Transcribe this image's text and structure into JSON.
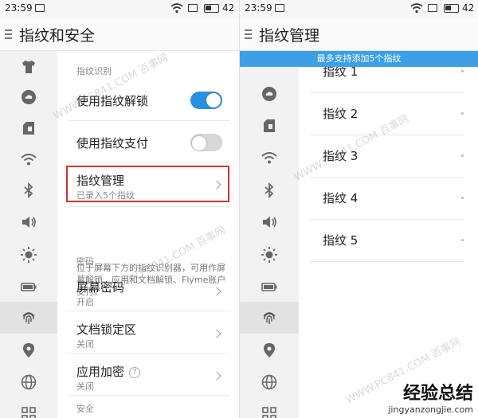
{
  "left": {
    "status": {
      "time": "23:59",
      "battery": "42"
    },
    "title": "指纹和安全",
    "section_fingerprint": "指纹识别",
    "unlock_label": "使用指纹解锁",
    "pay_label": "使用指纹支付",
    "manage_label": "指纹管理",
    "manage_sub": "已录入5个指纹",
    "description": "位于屏幕下方的指纹识别器，可用作屏幕解锁、应用和文档解锁、Flyme账户支付。",
    "section_password": "密码",
    "screen_pw_label": "屏幕密码",
    "screen_pw_sub": "开启",
    "doc_lock_label": "文档锁定区",
    "doc_lock_sub": "关闭",
    "app_enc_label": "应用加密",
    "app_enc_sub": "关闭",
    "help_glyph": "?",
    "section_security": "安全"
  },
  "right": {
    "status": {
      "time": "23:59",
      "battery": "42"
    },
    "title": "指纹管理",
    "banner": "最多支持添加5个指纹",
    "fingerprints": [
      "指纹 1",
      "指纹 2",
      "指纹 3",
      "指纹 4",
      "指纹 5"
    ]
  },
  "watermark": "WWW.PC841.COM 百事网",
  "corner_logo": {
    "mark": "经验总结",
    "url": "jingyanzongjie.com"
  },
  "colors": {
    "accent": "#2a8fdf",
    "banner": "#3da0e6",
    "highlight": "#d9302c"
  }
}
